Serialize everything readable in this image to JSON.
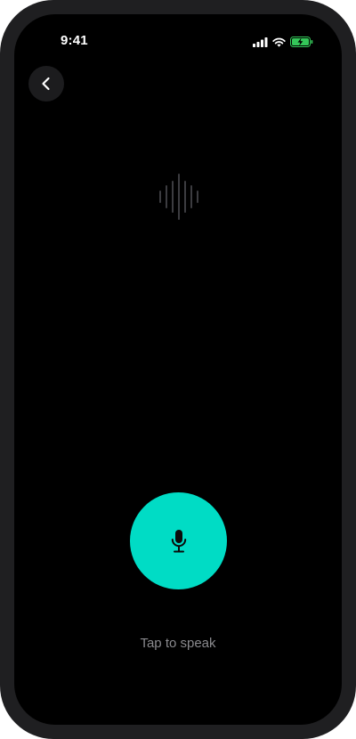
{
  "status_bar": {
    "time": "9:41",
    "icons": [
      "cellular-signal-icon",
      "wifi-icon",
      "battery-charging-icon"
    ],
    "battery_color": "#34c759"
  },
  "navigation": {
    "back_icon": "chevron-left-icon"
  },
  "voice": {
    "waveform_icon": "sound-wave-icon",
    "mic_icon": "microphone-icon",
    "mic_button_color": "#00dcc5",
    "hint": "Tap to speak"
  },
  "colors": {
    "background": "#000000",
    "frame": "#1f1f21",
    "hint_text": "#8a8a8e"
  }
}
